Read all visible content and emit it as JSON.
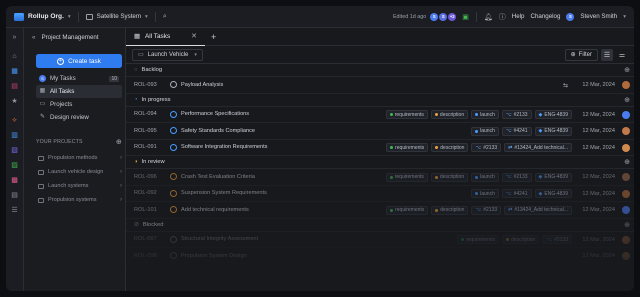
{
  "header": {
    "org": "Rollup Org.",
    "system": "Satellite System",
    "edited": "Edited 1d ago",
    "collab_extra": "+2",
    "help": "Help",
    "changelog": "Changelog",
    "user": "Steven Smith",
    "user_initial": "S"
  },
  "sidebar": {
    "title": "Project Management",
    "create_label": "Create task",
    "nav": [
      {
        "label": "My Tasks",
        "count": "10"
      },
      {
        "label": "All Tasks"
      },
      {
        "label": "Projects"
      },
      {
        "label": "Design review"
      }
    ],
    "projects_header": "YOUR PROJECTS",
    "projects": [
      "Propulsion methods",
      "Launch vehicle design",
      "Launch systems",
      "Propulsion systems"
    ]
  },
  "tabs": [
    {
      "label": "All Tasks"
    }
  ],
  "toolbar": {
    "view": "Launch Vehicle",
    "filter": "Filter"
  },
  "groups": {
    "backlog": "Backlog",
    "in_progress": "In progress",
    "in_review": "In review",
    "blocked": "Blocked"
  },
  "rows": {
    "backlog": [
      {
        "id": "ROL-093",
        "title": "Payload Analysis",
        "date": "12 Mar, 2024"
      }
    ],
    "in_progress": [
      {
        "id": "ROL-094",
        "title": "Performance Specifications",
        "chips": [
          "requirements",
          "description",
          "launch",
          "#2133",
          "ENG-4839"
        ],
        "date": "12 Mar, 2024"
      },
      {
        "id": "ROL-095",
        "title": "Safety Standards Compliance",
        "chips": [
          "launch",
          "#4241",
          "ENG-4839"
        ],
        "date": "12 Mar, 2024"
      },
      {
        "id": "ROL-091",
        "title": "Software Integration Requirements",
        "chips": [
          "requirements",
          "description",
          "#2133",
          "#13424_Add technical..."
        ],
        "date": "12 Mar, 2024"
      }
    ],
    "in_review": [
      {
        "id": "ROL-096",
        "title": "Crash Test Evaluation Criteria",
        "chips": [
          "requirements",
          "description",
          "launch",
          "#2133",
          "ENG-4839"
        ],
        "date": "12 Mar, 2024"
      },
      {
        "id": "ROL-092",
        "title": "Suspension System Requirements",
        "chips": [
          "launch",
          "#4241",
          "ENG-4839"
        ],
        "date": "12 Mar, 2024"
      },
      {
        "id": "ROL-101",
        "title": "Add technical requirements",
        "chips": [
          "requirements",
          "description",
          "#2133",
          "#13424_Add technical..."
        ],
        "date": "12 Mar, 2024"
      }
    ],
    "blocked": [
      {
        "id": "ROL-097",
        "title": "Structural Integrity Assessment",
        "chips": [
          "requirements",
          "description",
          "#2133"
        ],
        "date": "12 Mar, 2024"
      },
      {
        "id": "ROL-098",
        "title": "Propulsion System Design",
        "date": "12 Mar, 2024"
      }
    ]
  },
  "colors": {
    "accent": "#2f7bf0",
    "requirements": "#3fb950",
    "description": "#f0a23b",
    "launch": "#4a9cff"
  }
}
